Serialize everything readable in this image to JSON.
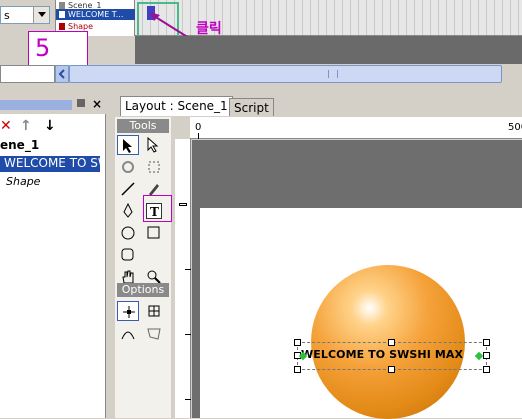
{
  "timeline": {
    "layer_dropdown_value": "s",
    "layers": [
      "Scene_1",
      "WELCOME T...",
      "Shape"
    ],
    "annotation_label": "클릭",
    "step_number": "5"
  },
  "scene_panel": {
    "tree_scene": "ene_1",
    "tree_selected": "WELCOME TO SWSHI MAX",
    "tree_shape": "Shape"
  },
  "tabs": [
    {
      "label": "Layout : Scene_1",
      "active": true
    },
    {
      "label": "Script",
      "active": false
    }
  ],
  "tools": {
    "header": "Tools",
    "options_header": "Options"
  },
  "ruler": {
    "top_labels": [
      "0",
      "500"
    ]
  },
  "stage": {
    "text_object": "WELCOME TO SWSHI MAX"
  },
  "colors": {
    "accent_selection": "#1f4ca8",
    "annotation": "#c000c0",
    "frame_highlight": "#4ab88a"
  }
}
